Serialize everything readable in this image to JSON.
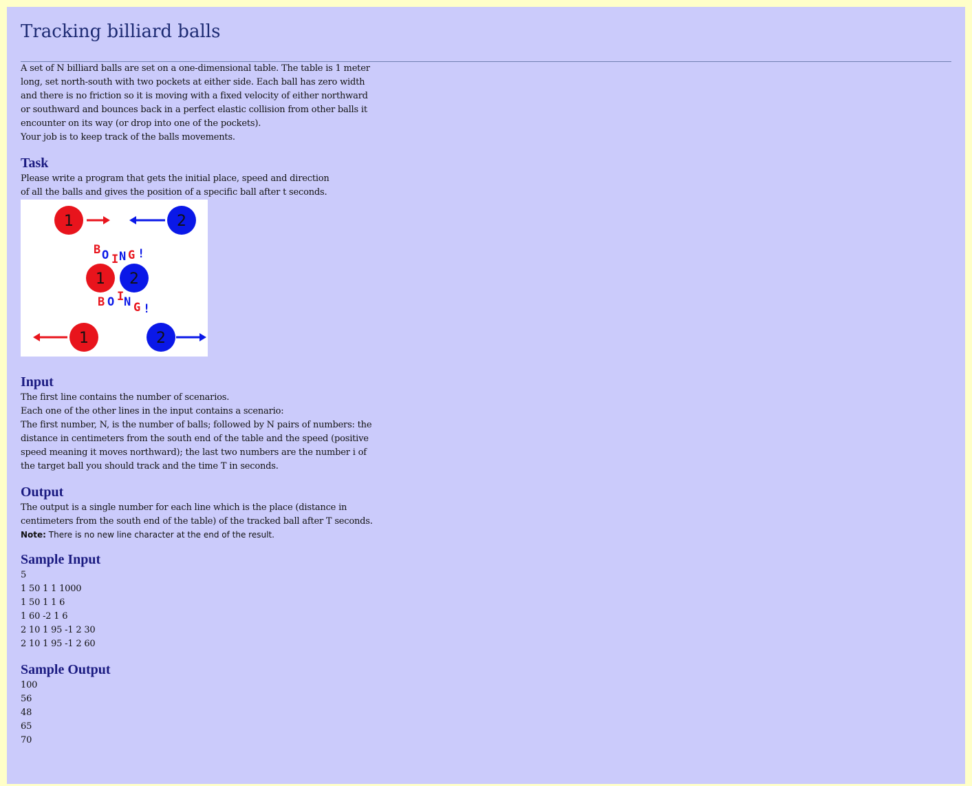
{
  "title": "Tracking billiard balls",
  "intro": [
    "A set of N billiard balls are set on a one-dimensional table. The table is 1 meter long, set north-south with two pockets at either side. Each ball has zero width and there is no friction so it is moving with a fixed velocity of either northward or southward and bounces back in a perfect elastic collision from other balls it encounter on its way (or drop into one of the pockets).",
    "Your job is to keep track of the balls movements."
  ],
  "task": {
    "heading": "Task",
    "text": "Please write a program that gets the initial place, speed and direction of all the balls and gives the position of a specific ball after t seconds."
  },
  "figure": {
    "colors": {
      "red": "#e8141c",
      "blue": "#0a18e8"
    },
    "ball1": "1",
    "ball2": "2",
    "boing_top": [
      "B",
      "O",
      "I",
      "N",
      "G",
      "!"
    ],
    "boing_bottom": [
      "B",
      "O",
      "I",
      "N",
      "G",
      "!"
    ]
  },
  "input": {
    "heading": "Input",
    "lines": [
      "The first line contains the number of scenarios.",
      "Each one of the other lines in the input contains a scenario:",
      "The first number, N, is the number of balls; followed by N pairs of numbers: the distance in centimeters from the south end of the table and the speed (positive speed meaning it moves northward); the last two numbers are the number i of the target ball you should track and the time T in seconds."
    ]
  },
  "output": {
    "heading": "Output",
    "text": "The output is a single number for each line which is the place (distance in centimeters from the south end of the table) of the tracked ball after T seconds.",
    "note_label": "Note:",
    "note_text": " There is no new line character at the end of the result."
  },
  "sample_input": {
    "heading": "Sample Input",
    "lines": [
      "5",
      "1 50 1 1 1000",
      "1 50 1 1 6",
      "1 60 -2 1 6",
      "2 10 1 95 -1 2 30",
      "2 10 1 95 -1 2 60"
    ]
  },
  "sample_output": {
    "heading": "Sample Output",
    "lines": [
      "100",
      "56",
      "48",
      "65",
      "70"
    ]
  }
}
